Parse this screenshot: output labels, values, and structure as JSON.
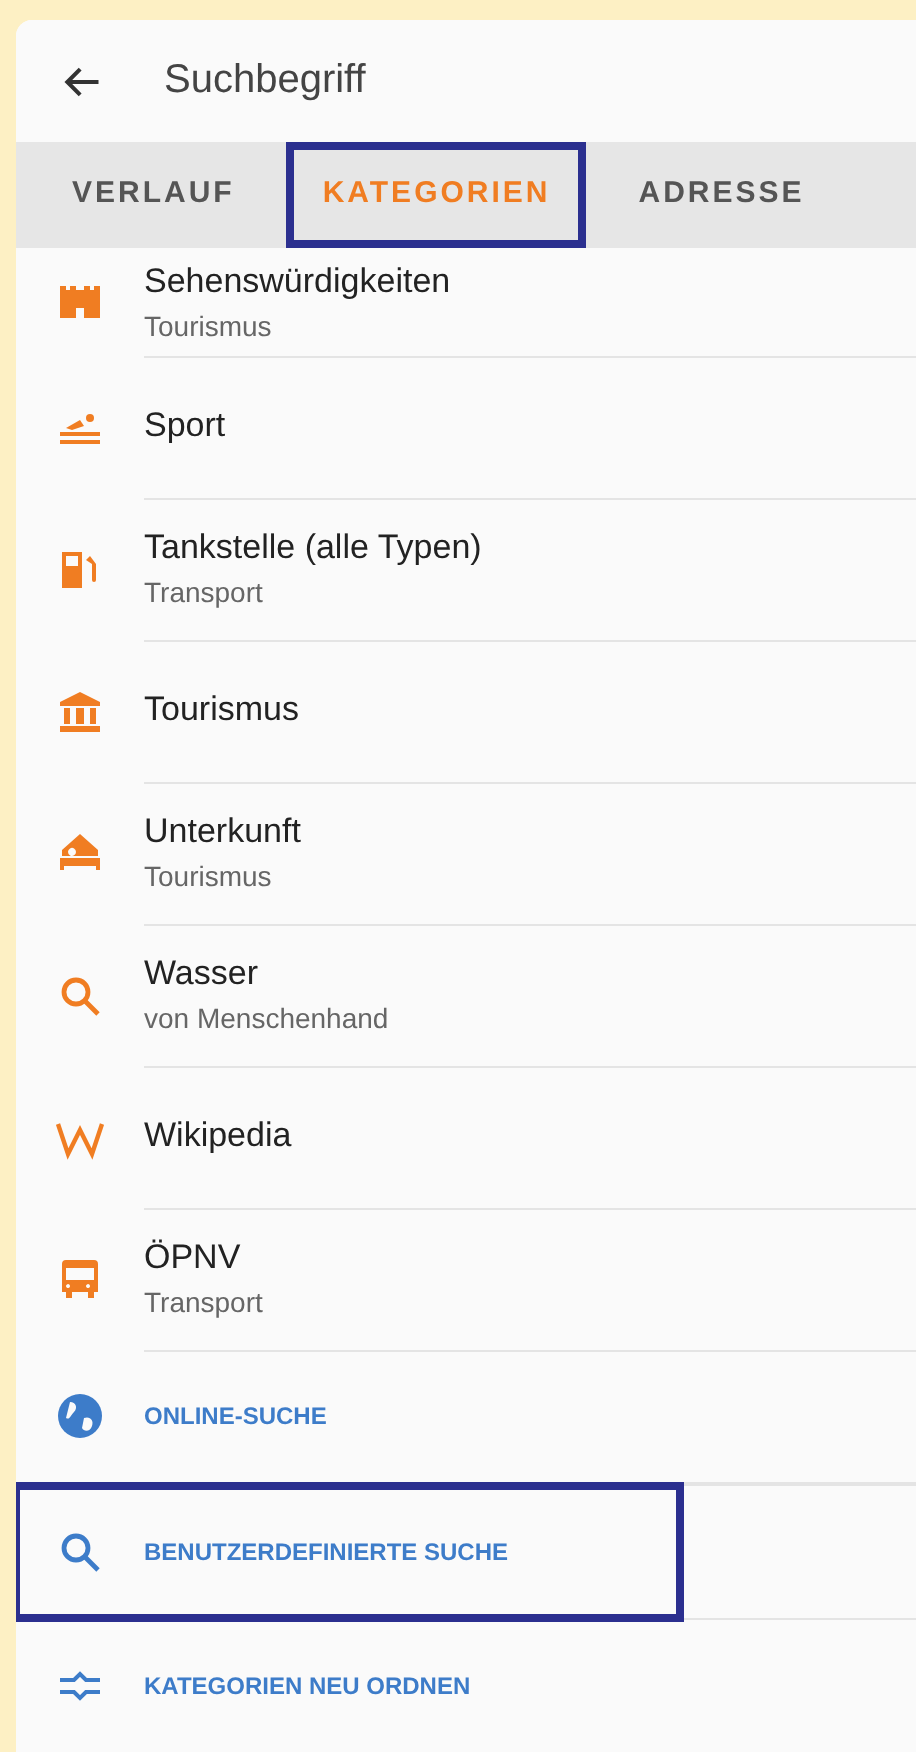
{
  "header": {
    "title": "Suchbegriff"
  },
  "tabs": [
    {
      "label": "VERLAUF",
      "selected": false,
      "highlighted": false
    },
    {
      "label": "KATEGORIEN",
      "selected": true,
      "highlighted": true
    },
    {
      "label": "ADRESSE",
      "selected": false,
      "highlighted": false
    }
  ],
  "categories": [
    {
      "kind": "category",
      "title": "Sehenswürdigkeiten",
      "subtitle": "Tourismus"
    },
    {
      "kind": "category",
      "title": "Sport"
    },
    {
      "kind": "category",
      "title": "Tankstelle (alle Typen)",
      "subtitle": "Transport"
    },
    {
      "kind": "category",
      "title": "Tourismus"
    },
    {
      "kind": "category",
      "title": "Unterkunft",
      "subtitle": "Tourismus"
    },
    {
      "kind": "category",
      "title": "Wasser",
      "subtitle": "von Menschenhand"
    },
    {
      "kind": "category",
      "title": "Wikipedia"
    },
    {
      "kind": "category",
      "title": "ÖPNV",
      "subtitle": "Transport"
    },
    {
      "kind": "action",
      "title": "ONLINE-SUCHE",
      "highlighted": false
    },
    {
      "kind": "action",
      "title": "BENUTZERDEFINIERTE SUCHE",
      "highlighted": true
    },
    {
      "kind": "action",
      "title": "KATEGORIEN NEU ORDNEN",
      "highlighted": false
    }
  ]
}
